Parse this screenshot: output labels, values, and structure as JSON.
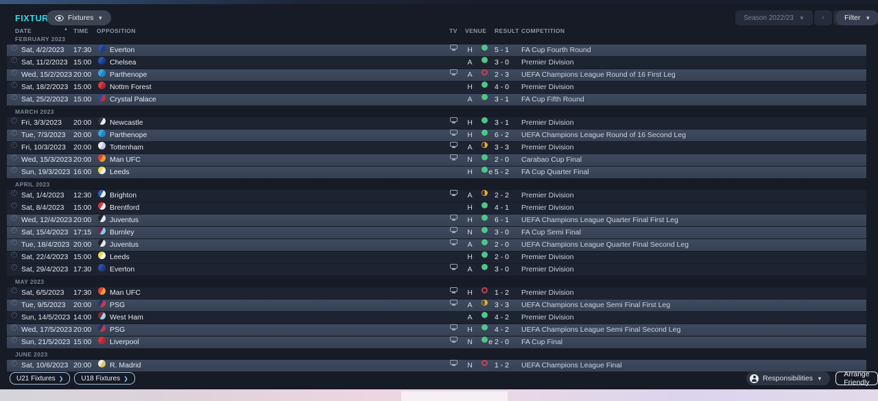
{
  "header": {
    "title": "FIXTURES",
    "view_label": "Fixtures",
    "season_label": "Season 2022/23",
    "prev": "‹",
    "next": "›",
    "filter_label": "Filter"
  },
  "columns": {
    "date": "DATE",
    "time": "TIME",
    "opposition": "OPPOSITION",
    "tv": "TV",
    "venue": "VENUE",
    "result": "RESULT",
    "competition": "COMPETITION"
  },
  "colors": {
    "accent_cyan": "#35D9EA",
    "win": "#4EC689",
    "draw": "#E3AC35",
    "loss": "#C2435A",
    "row_highlight": "#3A4659",
    "row_dark": "#1E2331",
    "background": "#161B26"
  },
  "teams": {
    "Everton": [
      "#2E4FA5",
      "#223C85"
    ],
    "Chelsea": [
      "#2256B0",
      "#183F8E"
    ],
    "Parthenope": [
      "#35A6DE",
      "#1F86C2"
    ],
    "Nottm Forest": [
      "#D93A42",
      "#B22730"
    ],
    "Crystal Palace": [
      "#2B4C9B",
      "#C0323F"
    ],
    "Newcastle": [
      "#31363F",
      "#E8EAEE"
    ],
    "Tottenham": [
      "#E8EBF1",
      "#C7CDD8"
    ],
    "Man UFC": [
      "#E0403A",
      "#E8A02C"
    ],
    "Leeds": [
      "#E9D94C",
      "#F2F3F0"
    ],
    "Brighton": [
      "#2E62B5",
      "#E8ECF2"
    ],
    "Brentford": [
      "#D8383F",
      "#E9EBEF"
    ],
    "Juventus": [
      "#23262D",
      "#E6E8EC"
    ],
    "Burnley": [
      "#73264C",
      "#8EC8E8"
    ],
    "PSG": [
      "#27356B",
      "#C23A50"
    ],
    "West Ham": [
      "#7E2A3C",
      "#9ED4E8"
    ],
    "Liverpool": [
      "#D1343C",
      "#B8262E"
    ],
    "R. Madrid": [
      "#EFE9D8",
      "#D8C36A"
    ]
  },
  "fixtures": {
    "sections": [
      {
        "label": "FEBRUARY 2023",
        "rows": [
          {
            "date": "Sat, 4/2/2023",
            "time": "17:30",
            "team": "Everton",
            "tv": true,
            "venue": "H",
            "outcome": "win",
            "score": "5 - 1",
            "competition": "FA Cup Fourth Round",
            "highlight": true
          },
          {
            "date": "Sat, 11/2/2023",
            "time": "15:00",
            "team": "Chelsea",
            "tv": false,
            "venue": "A",
            "outcome": "win",
            "score": "3 - 0",
            "competition": "Premier Division",
            "highlight": false
          },
          {
            "date": "Wed, 15/2/2023",
            "time": "20:00",
            "team": "Parthenope",
            "tv": true,
            "venue": "A",
            "outcome": "loss",
            "score": "2 - 3",
            "competition": "UEFA Champions League Round of 16  First Leg",
            "highlight": true
          },
          {
            "date": "Sat, 18/2/2023",
            "time": "15:00",
            "team": "Nottm Forest",
            "tv": false,
            "venue": "H",
            "outcome": "win",
            "score": "4 - 0",
            "competition": "Premier Division",
            "highlight": false
          },
          {
            "date": "Sat, 25/2/2023",
            "time": "15:00",
            "team": "Crystal Palace",
            "tv": false,
            "venue": "A",
            "outcome": "win",
            "score": "3 - 1",
            "competition": "FA Cup Fifth Round",
            "highlight": true
          }
        ]
      },
      {
        "label": "MARCH 2023",
        "rows": [
          {
            "date": "Fri, 3/3/2023",
            "time": "20:00",
            "team": "Newcastle",
            "tv": true,
            "venue": "H",
            "outcome": "win",
            "score": "3 - 1",
            "competition": "Premier Division",
            "highlight": false
          },
          {
            "date": "Tue, 7/3/2023",
            "time": "20:00",
            "team": "Parthenope",
            "tv": true,
            "venue": "H",
            "outcome": "win",
            "score": "6 - 2",
            "competition": "UEFA Champions League Round of 16  Second Leg",
            "highlight": true
          },
          {
            "date": "Fri, 10/3/2023",
            "time": "20:00",
            "team": "Tottenham",
            "tv": true,
            "venue": "A",
            "outcome": "draw",
            "score": "3 - 3",
            "competition": "Premier Division",
            "highlight": false
          },
          {
            "date": "Wed, 15/3/2023",
            "time": "20:00",
            "team": "Man UFC",
            "tv": true,
            "venue": "N",
            "outcome": "win",
            "score": "2 - 0",
            "competition": "Carabao Cup Final",
            "highlight": true
          },
          {
            "date": "Sun, 19/3/2023",
            "time": "16:00",
            "team": "Leeds",
            "tv": false,
            "venue": "H",
            "outcome": "win",
            "score": "e 5 - 2",
            "competition": "FA Cup Quarter Final",
            "highlight": true
          }
        ]
      },
      {
        "label": "APRIL 2023",
        "rows": [
          {
            "date": "Sat, 1/4/2023",
            "time": "12:30",
            "team": "Brighton",
            "tv": true,
            "venue": "A",
            "outcome": "draw",
            "score": "2 - 2",
            "competition": "Premier Division",
            "highlight": false
          },
          {
            "date": "Sat, 8/4/2023",
            "time": "15:00",
            "team": "Brentford",
            "tv": false,
            "venue": "H",
            "outcome": "win",
            "score": "4 - 1",
            "competition": "Premier Division",
            "highlight": false
          },
          {
            "date": "Wed, 12/4/2023",
            "time": "20:00",
            "team": "Juventus",
            "tv": true,
            "venue": "H",
            "outcome": "win",
            "score": "6 - 1",
            "competition": "UEFA Champions League Quarter Final First Leg",
            "highlight": true
          },
          {
            "date": "Sat, 15/4/2023",
            "time": "17:15",
            "team": "Burnley",
            "tv": true,
            "venue": "N",
            "outcome": "win",
            "score": "3 - 0",
            "competition": "FA Cup Semi Final",
            "highlight": true
          },
          {
            "date": "Tue, 18/4/2023",
            "time": "20:00",
            "team": "Juventus",
            "tv": true,
            "venue": "A",
            "outcome": "win",
            "score": "2 - 0",
            "competition": "UEFA Champions League Quarter Final Second Leg",
            "highlight": true
          },
          {
            "date": "Sat, 22/4/2023",
            "time": "15:00",
            "team": "Leeds",
            "tv": false,
            "venue": "H",
            "outcome": "win",
            "score": "2 - 0",
            "competition": "Premier Division",
            "highlight": false
          },
          {
            "date": "Sat, 29/4/2023",
            "time": "17:30",
            "team": "Everton",
            "tv": true,
            "venue": "A",
            "outcome": "win",
            "score": "3 - 0",
            "competition": "Premier Division",
            "highlight": false
          }
        ]
      },
      {
        "label": "MAY 2023",
        "rows": [
          {
            "date": "Sat, 6/5/2023",
            "time": "17:30",
            "team": "Man UFC",
            "tv": true,
            "venue": "H",
            "outcome": "loss",
            "score": "1 - 2",
            "competition": "Premier Division",
            "highlight": false
          },
          {
            "date": "Tue, 9/5/2023",
            "time": "20:00",
            "team": "PSG",
            "tv": true,
            "venue": "A",
            "outcome": "draw",
            "score": "3 - 3",
            "competition": "UEFA Champions League Semi Final First Leg",
            "highlight": true
          },
          {
            "date": "Sun, 14/5/2023",
            "time": "14:00",
            "team": "West Ham",
            "tv": false,
            "venue": "A",
            "outcome": "win",
            "score": "4 - 2",
            "competition": "Premier Division",
            "highlight": false
          },
          {
            "date": "Wed, 17/5/2023",
            "time": "20:00",
            "team": "PSG",
            "tv": true,
            "venue": "H",
            "outcome": "win",
            "score": "4 - 2",
            "competition": "UEFA Champions League Semi Final Second Leg",
            "highlight": true
          },
          {
            "date": "Sun, 21/5/2023",
            "time": "15:00",
            "team": "Liverpool",
            "tv": true,
            "venue": "N",
            "outcome": "win",
            "score": "e 2 - 0",
            "competition": "FA Cup Final",
            "highlight": true
          }
        ]
      },
      {
        "label": "JUNE 2023",
        "rows": [
          {
            "date": "Sat, 10/6/2023",
            "time": "20:00",
            "team": "R. Madrid",
            "tv": true,
            "venue": "N",
            "outcome": "loss",
            "score": "1 - 2",
            "competition": "UEFA Champions League Final",
            "highlight": true
          }
        ]
      }
    ]
  },
  "footer": {
    "u21_label": "U21 Fixtures",
    "u18_label": "U18 Fixtures",
    "responsibilities_label": "Responsibilities",
    "arrange_friendly_label": "Arrange Friendly"
  }
}
